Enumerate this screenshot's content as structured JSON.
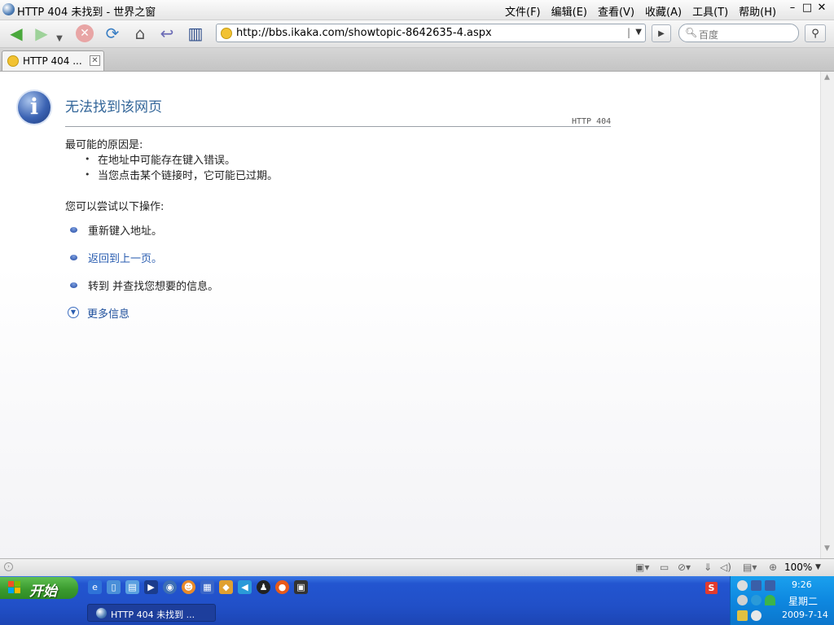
{
  "window": {
    "title": "HTTP 404 未找到 - 世界之窗",
    "menu": [
      "文件(F)",
      "编辑(E)",
      "查看(V)",
      "收藏(A)",
      "工具(T)",
      "帮助(H)"
    ],
    "controls": [
      "–",
      "□",
      "✕"
    ]
  },
  "toolbar": {
    "address": "http://bbs.ikaka.com/showtopic-8642635-4.aspx",
    "search_placeholder": "百度"
  },
  "tab": {
    "title": "HTTP 404 ..."
  },
  "content": {
    "title": "无法找到该网页",
    "code": "HTTP 404",
    "causes_heading": "最可能的原因是:",
    "causes": [
      "在地址中可能存在键入错误。",
      "当您点击某个链接时，它可能已过期。"
    ],
    "actions_heading": "您可以尝试以下操作:",
    "actions": [
      "重新键入地址。",
      "返回到上一页。",
      "转到   并查找您想要的信息。"
    ],
    "more_info": "更多信息"
  },
  "statusbar": {
    "zoom": "100%"
  },
  "taskbar": {
    "start_label": "开始",
    "task_title": "HTTP 404 未找到 ...",
    "clock_time": "9:26",
    "clock_day": "星期二",
    "clock_date": "2009-7-14"
  },
  "colors": {
    "title_blue": "#336699",
    "link_blue": "#2a5db0",
    "taskbar_blue": "#2150c8",
    "start_green": "#3b9b2f",
    "tray_blue": "#0e88e0"
  }
}
